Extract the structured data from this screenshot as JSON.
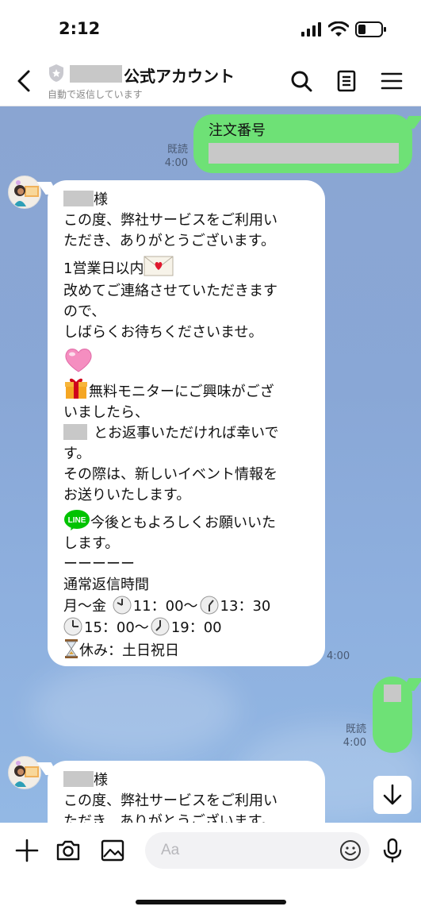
{
  "status_bar": {
    "time": "2:12"
  },
  "header": {
    "title": "公式アカウント",
    "subtitle": "自動で返信しています"
  },
  "messages": {
    "m1": {
      "line1": "注文番号",
      "read": "既読",
      "time": "4:00"
    },
    "m2": {
      "lines": [
        "様",
        "この度、弊社サービスをご利用い",
        "ただき、ありがとうございます。",
        "1営業日以内",
        "改めてご連絡させていただきます",
        "ので、",
        "しばらくお待ちくださいませ。",
        "無料モニターにご興味がござ",
        "いましたら、",
        "とお返事いただければ幸いで",
        "す。",
        "その際は、新しいイベント情報を",
        "お送りいたします。",
        "今後ともよろしくお願いいた",
        "します。",
        "ーーーーー",
        "通常返信時間",
        "月～金 ",
        "11：00～",
        "13：30",
        "15：00～",
        "19：00",
        "休み：土日祝日"
      ],
      "time": "4:00"
    },
    "m3": {
      "read": "既読",
      "time": "4:00"
    },
    "m4": {
      "line1": "様",
      "line2": "この度、弊社サービスをご利用い",
      "line3": "ただき、ありがとうございます。"
    }
  },
  "input": {
    "placeholder": "Aa"
  },
  "colors": {
    "my_bubble": "#6ee176",
    "chat_bg": "#8aa5d2",
    "their_bubble": "#ffffff"
  },
  "icons": [
    "back-icon",
    "shield-icon",
    "search-icon",
    "notes-icon",
    "menu-icon",
    "plus-icon",
    "camera-icon",
    "image-icon",
    "emoji-icon",
    "mic-icon",
    "arrow-down-icon"
  ]
}
